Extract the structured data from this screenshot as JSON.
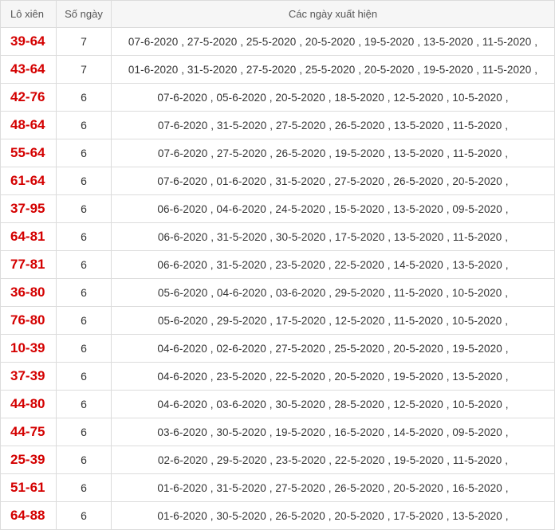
{
  "table": {
    "headers": [
      "Lô xiên",
      "Số ngày",
      "Các ngày xuất hiện"
    ],
    "rows": [
      {
        "pair": "39-64",
        "days": "7",
        "dates": "07-6-2020 , 27-5-2020 , 25-5-2020 , 20-5-2020 , 19-5-2020 , 13-5-2020 , 11-5-2020 ,"
      },
      {
        "pair": "43-64",
        "days": "7",
        "dates": "01-6-2020 , 31-5-2020 , 27-5-2020 , 25-5-2020 , 20-5-2020 , 19-5-2020 , 11-5-2020 ,"
      },
      {
        "pair": "42-76",
        "days": "6",
        "dates": "07-6-2020 , 05-6-2020 , 20-5-2020 , 18-5-2020 , 12-5-2020 , 10-5-2020 ,"
      },
      {
        "pair": "48-64",
        "days": "6",
        "dates": "07-6-2020 , 31-5-2020 , 27-5-2020 , 26-5-2020 , 13-5-2020 , 11-5-2020 ,"
      },
      {
        "pair": "55-64",
        "days": "6",
        "dates": "07-6-2020 , 27-5-2020 , 26-5-2020 , 19-5-2020 , 13-5-2020 , 11-5-2020 ,"
      },
      {
        "pair": "61-64",
        "days": "6",
        "dates": "07-6-2020 , 01-6-2020 , 31-5-2020 , 27-5-2020 , 26-5-2020 , 20-5-2020 ,"
      },
      {
        "pair": "37-95",
        "days": "6",
        "dates": "06-6-2020 , 04-6-2020 , 24-5-2020 , 15-5-2020 , 13-5-2020 , 09-5-2020 ,"
      },
      {
        "pair": "64-81",
        "days": "6",
        "dates": "06-6-2020 , 31-5-2020 , 30-5-2020 , 17-5-2020 , 13-5-2020 , 11-5-2020 ,"
      },
      {
        "pair": "77-81",
        "days": "6",
        "dates": "06-6-2020 , 31-5-2020 , 23-5-2020 , 22-5-2020 , 14-5-2020 , 13-5-2020 ,"
      },
      {
        "pair": "36-80",
        "days": "6",
        "dates": "05-6-2020 , 04-6-2020 , 03-6-2020 , 29-5-2020 , 11-5-2020 , 10-5-2020 ,"
      },
      {
        "pair": "76-80",
        "days": "6",
        "dates": "05-6-2020 , 29-5-2020 , 17-5-2020 , 12-5-2020 , 11-5-2020 , 10-5-2020 ,"
      },
      {
        "pair": "10-39",
        "days": "6",
        "dates": "04-6-2020 , 02-6-2020 , 27-5-2020 , 25-5-2020 , 20-5-2020 , 19-5-2020 ,"
      },
      {
        "pair": "37-39",
        "days": "6",
        "dates": "04-6-2020 , 23-5-2020 , 22-5-2020 , 20-5-2020 , 19-5-2020 , 13-5-2020 ,"
      },
      {
        "pair": "44-80",
        "days": "6",
        "dates": "04-6-2020 , 03-6-2020 , 30-5-2020 , 28-5-2020 , 12-5-2020 , 10-5-2020 ,"
      },
      {
        "pair": "44-75",
        "days": "6",
        "dates": "03-6-2020 , 30-5-2020 , 19-5-2020 , 16-5-2020 , 14-5-2020 , 09-5-2020 ,"
      },
      {
        "pair": "25-39",
        "days": "6",
        "dates": "02-6-2020 , 29-5-2020 , 23-5-2020 , 22-5-2020 , 19-5-2020 , 11-5-2020 ,"
      },
      {
        "pair": "51-61",
        "days": "6",
        "dates": "01-6-2020 , 31-5-2020 , 27-5-2020 , 26-5-2020 , 20-5-2020 , 16-5-2020 ,"
      },
      {
        "pair": "64-88",
        "days": "6",
        "dates": "01-6-2020 , 30-5-2020 , 26-5-2020 , 20-5-2020 , 17-5-2020 , 13-5-2020 ,"
      }
    ]
  }
}
